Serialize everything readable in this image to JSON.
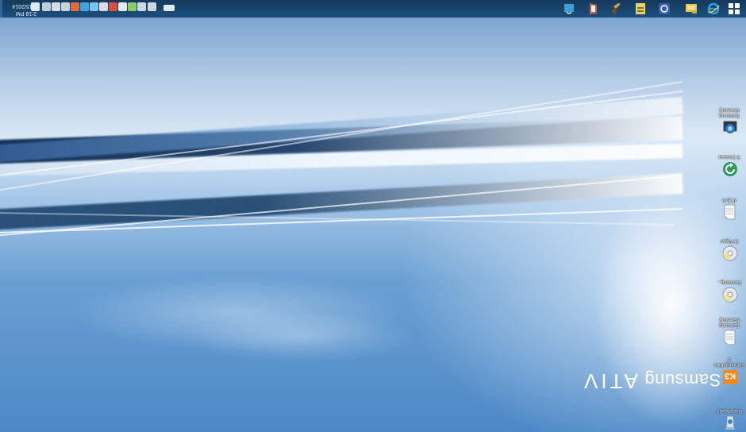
{
  "desktop": {
    "brand_name": "Samsung",
    "brand_model": "ATIV",
    "icons": [
      {
        "label": "Recycle Bin",
        "icon": "recycle-bin-icon"
      },
      {
        "label": "Samsung Kies 3",
        "icon": "kies-icon"
      },
      {
        "label": "Samsung Recovery",
        "icon": "document-icon"
      },
      {
        "label": "Samsung...",
        "icon": "cd-icon"
      },
      {
        "label": "S Player",
        "icon": "cd-icon"
      },
      {
        "label": "새 문서",
        "icon": "document-icon"
      },
      {
        "label": "S Camera",
        "icon": "refresh-green-icon"
      },
      {
        "label": "Samsung Recovery",
        "icon": "camera-box-icon"
      }
    ]
  },
  "taskbar": {
    "start_icon": "windows-start-icon",
    "pinned": [
      {
        "name": "internet-explorer-icon",
        "color": "#1f9ae0"
      },
      {
        "name": "file-explorer-icon",
        "color": "#e8c24a"
      },
      {
        "name": "media-player-icon",
        "color": "#3a5db0"
      },
      {
        "name": "notes-icon",
        "color": "#e6d36a"
      },
      {
        "name": "tool-icon",
        "color": "#d4a33b"
      },
      {
        "name": "office-icon",
        "color": "#e0552b"
      },
      {
        "name": "store-icon",
        "color": "#3ca0d8"
      }
    ],
    "tray_icons": [
      "keyboard-icon",
      "network-icon",
      "volume-icon",
      "battery-icon",
      "security-icon",
      "flag-icon",
      "bluetooth-icon",
      "cloud-icon",
      "skype-icon",
      "update-icon",
      "ime-icon",
      "sync-icon",
      "arrow-icon",
      "notification-icon"
    ],
    "clock_time": "2:18 PM",
    "clock_date": "12/15/2014"
  }
}
